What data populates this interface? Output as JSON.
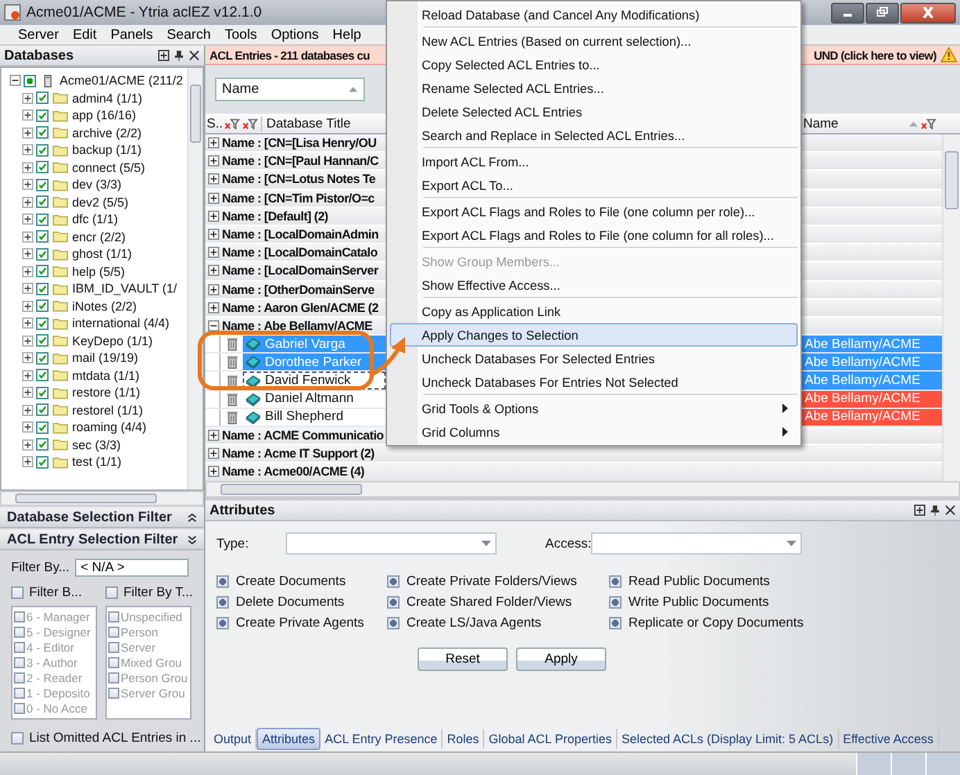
{
  "window": {
    "title": "Acme01/ACME - Ytria aclEZ v12.1.0"
  },
  "menu_bar": [
    "Server",
    "Edit",
    "Panels",
    "Search",
    "Tools",
    "Options",
    "Help"
  ],
  "databases_panel": {
    "title": "Databases",
    "server": {
      "label": "Acme01/ACME (211/2",
      "expanded": true,
      "indeterminate": true
    },
    "items": [
      {
        "label": "admin4 (1/1)",
        "checked": true
      },
      {
        "label": "app (16/16)",
        "checked": true
      },
      {
        "label": "archive (2/2)",
        "checked": true
      },
      {
        "label": "backup (1/1)",
        "checked": true
      },
      {
        "label": "connect (5/5)",
        "checked": true
      },
      {
        "label": "dev (3/3)",
        "checked": true
      },
      {
        "label": "dev2 (5/5)",
        "checked": true
      },
      {
        "label": "dfc (1/1)",
        "checked": true
      },
      {
        "label": "encr (2/2)",
        "checked": true
      },
      {
        "label": "ghost (1/1)",
        "checked": true
      },
      {
        "label": "help (5/5)",
        "checked": true
      },
      {
        "label": "IBM_ID_VAULT (1/",
        "checked": true
      },
      {
        "label": "iNotes (2/2)",
        "checked": true
      },
      {
        "label": "international (4/4)",
        "checked": true
      },
      {
        "label": "KeyDepo (1/1)",
        "checked": true
      },
      {
        "label": "mail (19/19)",
        "checked": true
      },
      {
        "label": "mtdata (1/1)",
        "checked": true
      },
      {
        "label": "restore (1/1)",
        "checked": true
      },
      {
        "label": "restorel (1/1)",
        "checked": true
      },
      {
        "label": "roaming (4/4)",
        "checked": true
      },
      {
        "label": "sec (3/3)",
        "checked": true
      },
      {
        "label": "test (1/1)",
        "checked": true
      }
    ]
  },
  "selection_filters": [
    {
      "title": "Database Selection Filter",
      "expanded": false
    },
    {
      "title": "ACL Entry Selection Filter",
      "expanded": true
    }
  ],
  "acl_filter": {
    "filter_by_label": "Filter By...",
    "filter_by_value": "< N/A >",
    "lists": [
      {
        "label": "Filter B...",
        "checked": false,
        "items": [
          {
            "label": "6 - Manager",
            "checked": false,
            "disabled": true
          },
          {
            "label": "5 - Designer",
            "checked": false,
            "disabled": true
          },
          {
            "label": "4 - Editor",
            "checked": false,
            "disabled": true
          },
          {
            "label": "3 - Author",
            "checked": false,
            "disabled": true
          },
          {
            "label": "2 - Reader",
            "checked": false,
            "disabled": true
          },
          {
            "label": "1 - Deposito",
            "checked": false,
            "disabled": true
          },
          {
            "label": "0 - No Acce",
            "checked": false,
            "disabled": true
          }
        ]
      },
      {
        "label": "Filter By T...",
        "checked": false,
        "items": [
          {
            "label": "Unspecified",
            "checked": false,
            "disabled": true
          },
          {
            "label": "Person",
            "checked": false,
            "disabled": true
          },
          {
            "label": "Server",
            "checked": false,
            "disabled": true
          },
          {
            "label": "Mixed Grou",
            "checked": false,
            "disabled": true
          },
          {
            "label": "Person Grou",
            "checked": false,
            "disabled": true
          },
          {
            "label": "Server Grou",
            "checked": false,
            "disabled": true
          }
        ]
      }
    ],
    "omitted": {
      "label": "List Omitted ACL Entries in ...",
      "checked": false
    }
  },
  "acl_grid": {
    "banner_left": "ACL Entries - 211 databases cu",
    "banner_right": "UND (click here to view)",
    "group_by": "Name",
    "columns": [
      "S..",
      "Database Title",
      "Name"
    ],
    "rows": [
      {
        "label": "Name : [CN=[Lisa Henry/OU",
        "expanded": false
      },
      {
        "label": "Name : [CN=[Paul Hannan/C",
        "expanded": false
      },
      {
        "label": "Name : [CN=Lotus Notes Te",
        "expanded": false
      },
      {
        "label": "Name : [CN=Tim Pistor/O=c",
        "expanded": false
      },
      {
        "label": "Name : [Default] (2)",
        "expanded": false
      },
      {
        "label": "Name : [LocalDomainAdmin",
        "expanded": false
      },
      {
        "label": "Name : [LocalDomainCatalo",
        "expanded": false
      },
      {
        "label": "Name : [LocalDomainServer",
        "expanded": false
      },
      {
        "label": "Name : [OtherDomainServe",
        "expanded": false
      },
      {
        "label": "Name : Aaron Glen/ACME (2",
        "expanded": false
      },
      {
        "label": "Name : Abe Bellamy/ACME",
        "expanded": true,
        "children": [
          {
            "name": "Gabriel Varga",
            "selected": true,
            "focused": false,
            "name_column": "Abe Bellamy/ACME",
            "color": "#3399ff"
          },
          {
            "name": "Dorothee Parker",
            "selected": true,
            "focused": false,
            "name_column": "Abe Bellamy/ACME",
            "color": "#3399ff"
          },
          {
            "name": "David Fenwick",
            "selected": true,
            "focused": true,
            "name_column": "Abe Bellamy/ACME",
            "color": "#3399ff"
          },
          {
            "name": "Daniel Altmann",
            "selected": false,
            "focused": false,
            "name_column": "Abe Bellamy/ACME",
            "color": "#ff5340"
          },
          {
            "name": "Bill Shepherd",
            "selected": false,
            "focused": false,
            "name_column": "Abe Bellamy/ACME",
            "color": "#ff5340"
          }
        ]
      },
      {
        "label": "Name : ACME Communicatio",
        "expanded": false
      },
      {
        "label": "Name : Acme IT Support (2)",
        "expanded": false
      },
      {
        "label": "Name : Acme00/ACME (4)",
        "expanded": false
      }
    ]
  },
  "context_menu": {
    "groups": [
      [
        {
          "label": "Reload Database (and Cancel Any Modifications)",
          "disabled": false,
          "selected": false,
          "submenu": false
        }
      ],
      [
        {
          "label": "New ACL Entries (Based on current selection)...",
          "disabled": false,
          "selected": false,
          "submenu": false
        },
        {
          "label": "Copy Selected ACL Entries to...",
          "disabled": false,
          "selected": false,
          "submenu": false
        },
        {
          "label": "Rename Selected ACL Entries...",
          "disabled": false,
          "selected": false,
          "submenu": false
        },
        {
          "label": "Delete Selected ACL Entries",
          "disabled": false,
          "selected": false,
          "submenu": false
        },
        {
          "label": "Search and Replace in Selected ACL Entries...",
          "disabled": false,
          "selected": false,
          "submenu": false
        }
      ],
      [
        {
          "label": "Import ACL From...",
          "disabled": false,
          "selected": false,
          "submenu": false
        },
        {
          "label": "Export ACL To...",
          "disabled": false,
          "selected": false,
          "submenu": false
        }
      ],
      [
        {
          "label": "Export ACL Flags and Roles to File (one column per role)...",
          "disabled": false,
          "selected": false,
          "submenu": false
        },
        {
          "label": "Export ACL Flags and Roles to File (one column for all roles)...",
          "disabled": false,
          "selected": false,
          "submenu": false
        }
      ],
      [
        {
          "label": "Show Group Members...",
          "disabled": true,
          "selected": false,
          "submenu": false
        },
        {
          "label": "Show Effective Access...",
          "disabled": false,
          "selected": false,
          "submenu": false
        }
      ],
      [
        {
          "label": "Copy as Application Link",
          "disabled": false,
          "selected": false,
          "submenu": false
        },
        {
          "label": "Apply Changes to Selection",
          "disabled": false,
          "selected": true,
          "submenu": false
        },
        {
          "label": "Uncheck Databases For Selected Entries",
          "disabled": false,
          "selected": false,
          "submenu": false
        },
        {
          "label": "Uncheck Databases For Entries Not Selected",
          "disabled": false,
          "selected": false,
          "submenu": false
        }
      ],
      [
        {
          "label": "Grid Tools & Options",
          "disabled": false,
          "selected": false,
          "submenu": true
        },
        {
          "label": "Grid Columns",
          "disabled": false,
          "selected": false,
          "submenu": true
        }
      ]
    ]
  },
  "attributes": {
    "title": "Attributes",
    "type_label": "Type:",
    "access_label": "Access:",
    "options": [
      {
        "label": "Create Documents",
        "indeterminate": true
      },
      {
        "label": "Create Private Folders/Views",
        "indeterminate": true
      },
      {
        "label": "Read Public Documents",
        "indeterminate": true
      },
      {
        "label": "Delete Documents",
        "indeterminate": true
      },
      {
        "label": "Create Shared Folder/Views",
        "indeterminate": true
      },
      {
        "label": "Write Public Documents",
        "indeterminate": true
      },
      {
        "label": "Create Private Agents",
        "indeterminate": true
      },
      {
        "label": "Create LS/Java Agents",
        "indeterminate": true
      },
      {
        "label": "Replicate or Copy Documents",
        "indeterminate": true
      }
    ],
    "buttons": [
      "Reset",
      "Apply"
    ]
  },
  "bottom_tabs": [
    {
      "label": "Output",
      "selected": false
    },
    {
      "label": "Attributes",
      "selected": true
    },
    {
      "label": "ACL Entry Presence",
      "selected": false
    },
    {
      "label": "Roles",
      "selected": false
    },
    {
      "label": "Global ACL Properties",
      "selected": false
    },
    {
      "label": "Selected ACLs (Display Limit: 5 ACLs)",
      "selected": false
    },
    {
      "label": "Effective Access",
      "selected": false
    }
  ]
}
